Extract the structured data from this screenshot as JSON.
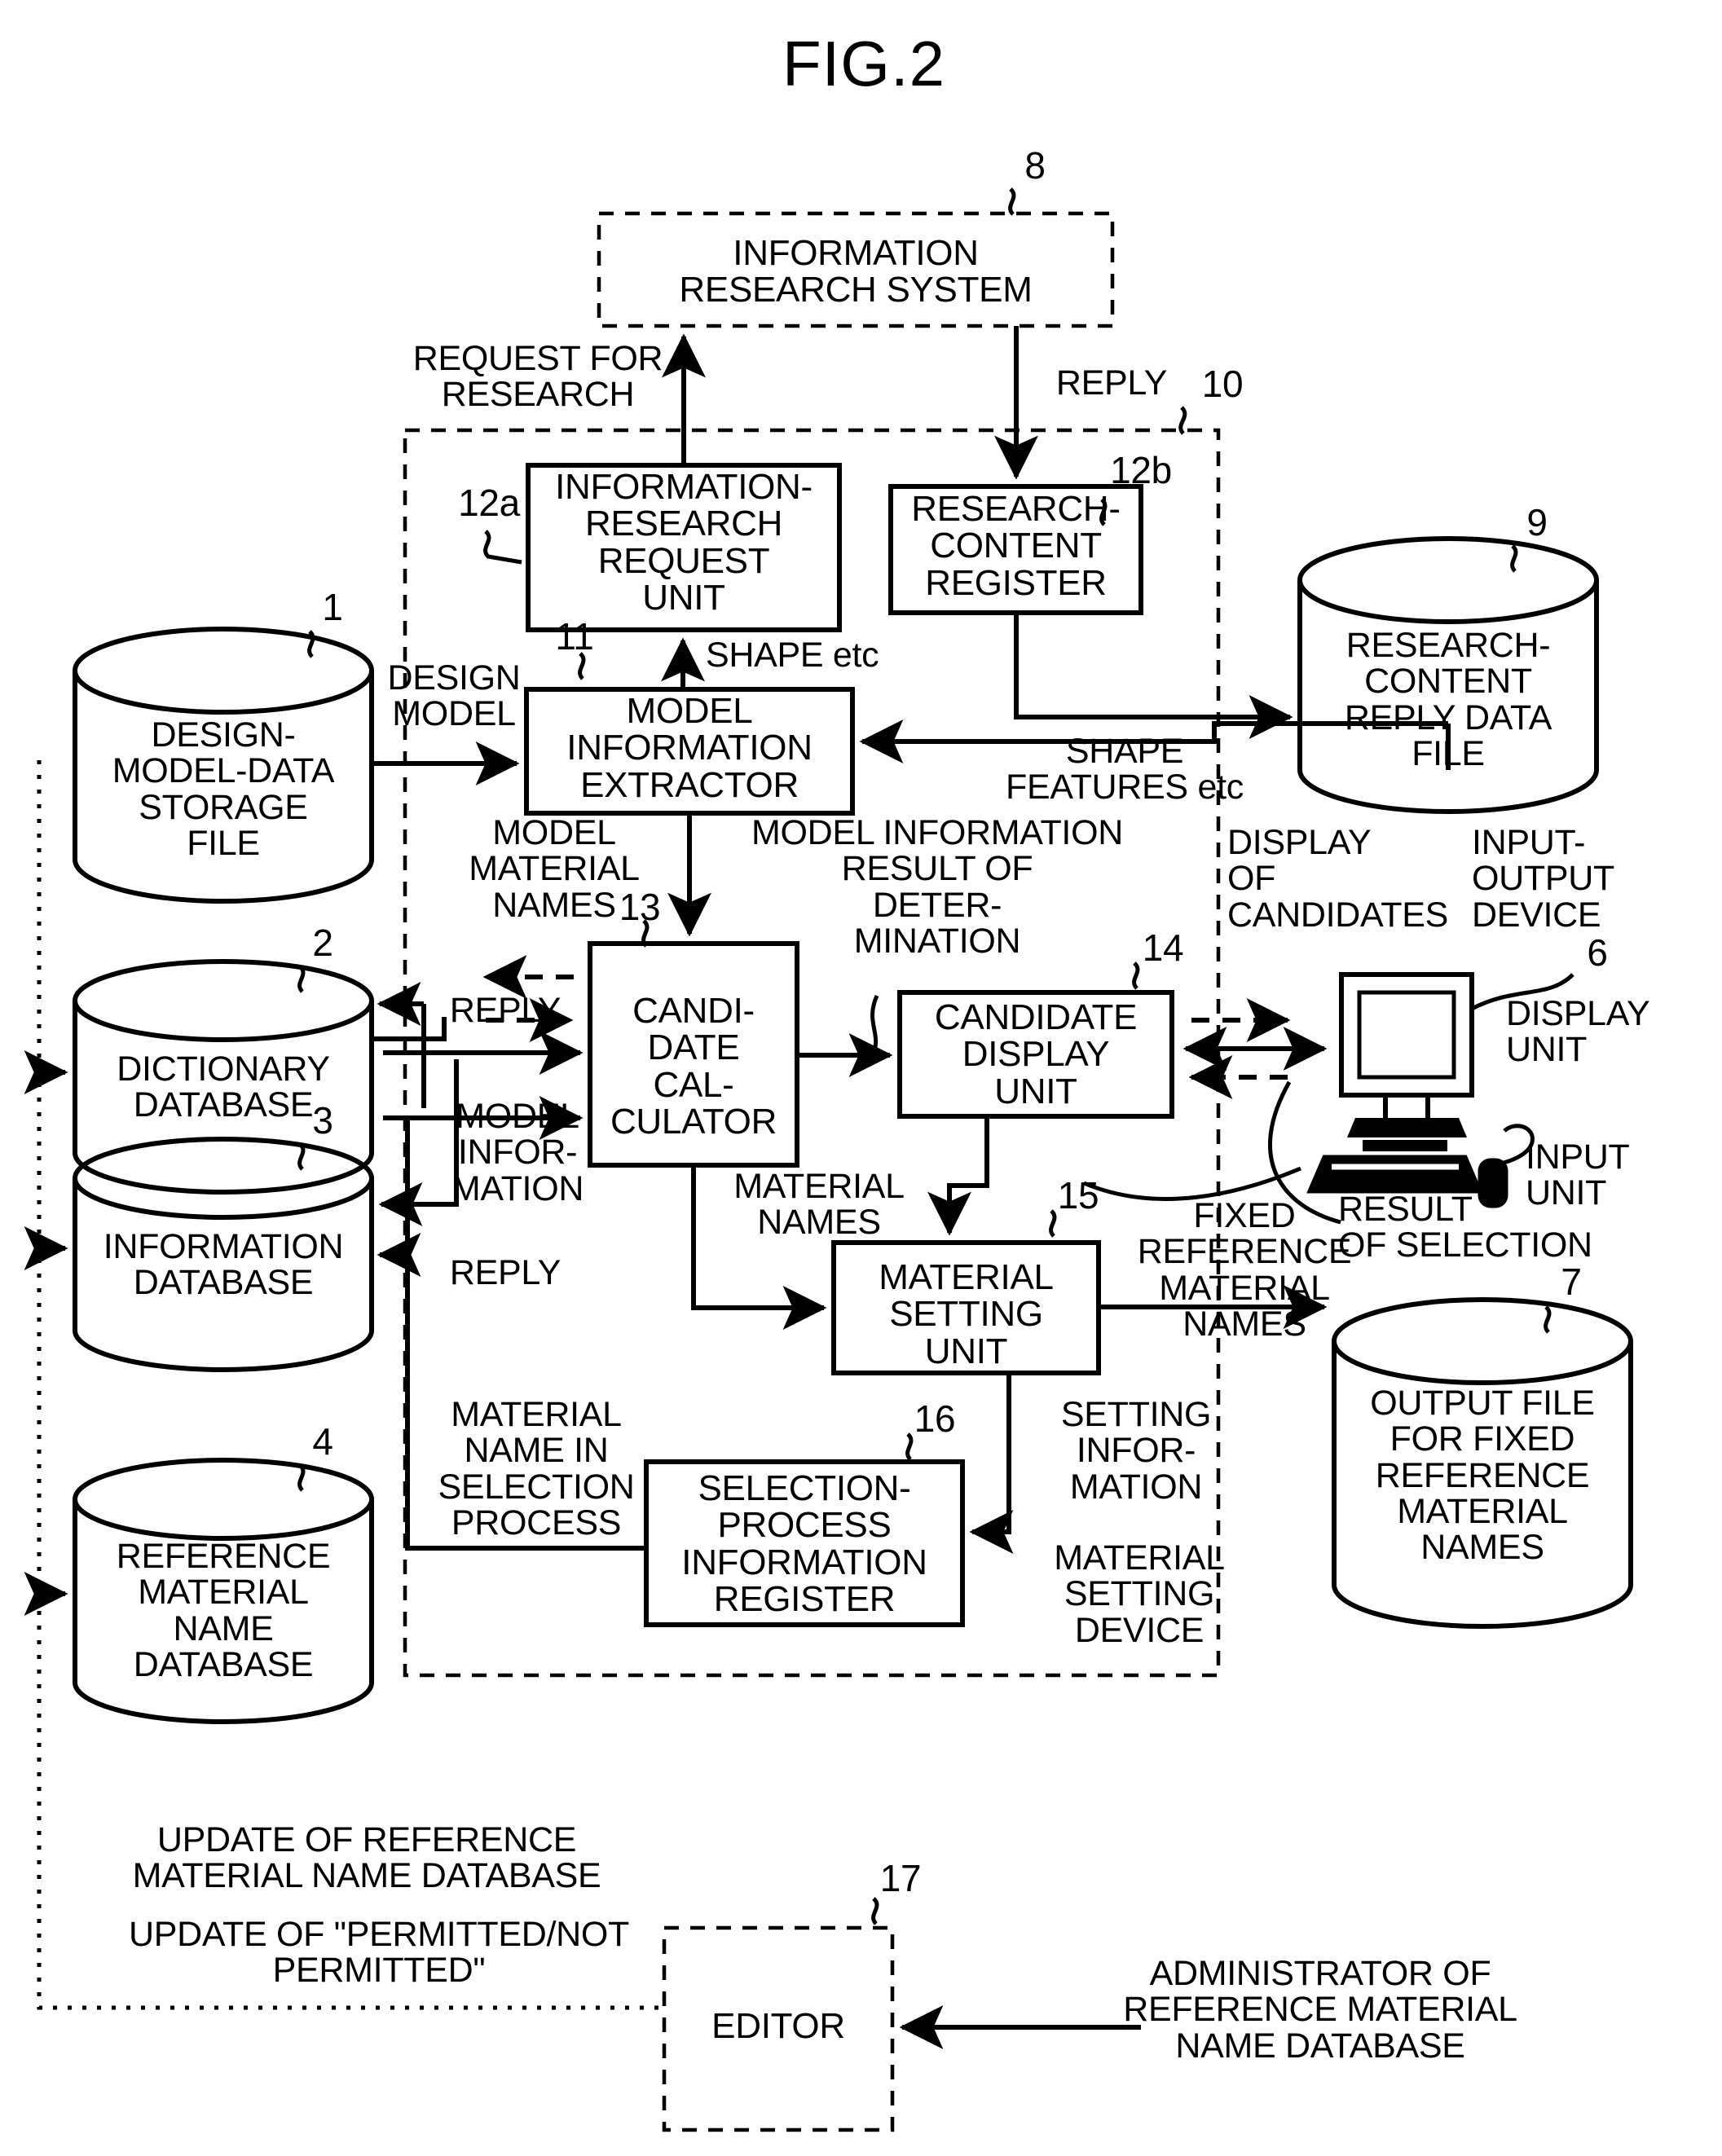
{
  "figure": {
    "title": "FIG.2"
  },
  "boxes": {
    "information_research_system": {
      "label": "INFORMATION\nRESEARCH SYSTEM",
      "ref": "8"
    },
    "information_research_request_unit": {
      "label": "INFORMATION-\nRESEARCH\nREQUEST\nUNIT",
      "ref": "12a"
    },
    "research_content_register": {
      "label": "RESEARCH-\nCONTENT\nREGISTER",
      "ref": "12b"
    },
    "model_information_extractor": {
      "label": "MODEL\nINFORMATION\nEXTRACTOR",
      "ref": "11"
    },
    "candidate_calculator": {
      "label": "CANDI-\nDATE\nCAL-\nCULATOR",
      "ref": "13"
    },
    "candidate_display_unit": {
      "label": "CANDIDATE\nDISPLAY\nUNIT",
      "ref": "14"
    },
    "material_setting_unit": {
      "label": "MATERIAL\nSETTING\nUNIT",
      "ref": "15"
    },
    "selection_process_information_register": {
      "label": "SELECTION-\nPROCESS\nINFORMATION\nREGISTER",
      "ref": "16"
    },
    "editor": {
      "label": "EDITOR",
      "ref": "17"
    },
    "system_boundary": {
      "ref": "10"
    }
  },
  "cylinders": {
    "design_model_data_storage_file": {
      "label": "DESIGN-\nMODEL-DATA\nSTORAGE\nFILE",
      "ref": "1"
    },
    "dictionary_database": {
      "label": "DICTIONARY\nDATABASE",
      "ref": "2"
    },
    "information_database": {
      "label": "INFORMATION\nDATABASE",
      "ref": "3"
    },
    "reference_material_name_database": {
      "label": "REFERENCE\nMATERIAL\nNAME\nDATABASE",
      "ref": "4"
    },
    "research_content_reply_data_file": {
      "label": "RESEARCH-\nCONTENT\nREPLY DATA\nFILE",
      "ref": "9"
    },
    "output_file_fixed_reference_material_names": {
      "label": "OUTPUT FILE\nFOR FIXED\nREFERENCE\nMATERIAL\nNAMES",
      "ref": "7"
    }
  },
  "device": {
    "input_output_device_label": "INPUT-\nOUTPUT\nDEVICE",
    "input_output_device_ref": "6",
    "display_unit_label": "DISPLAY\nUNIT",
    "input_unit_label": "INPUT\nUNIT"
  },
  "flow_labels": {
    "request_for_research": "REQUEST FOR\nRESEARCH",
    "reply_top": "REPLY",
    "design_model": "DESIGN\nMODEL",
    "shape_etc": "SHAPE etc",
    "shape_features_etc": "SHAPE\nFEATURES etc",
    "model_material_names": "MODEL\nMATERIAL\nNAMES",
    "reply_1": "REPLY",
    "model_information_left": "MODEL\nINFOR-\nMATION",
    "reply_2": "REPLY",
    "model_information_result": "MODEL INFORMATION\nRESULT OF\nDETER-\nMINATION",
    "display_of_candidates": "DISPLAY\nOF\nCANDIDATES",
    "material_names": "MATERIAL\nNAMES",
    "result_of_selection": "RESULT\nOF SELECTION",
    "fixed_reference_material_names": "FIXED\nREFERENCE\nMATERIAL\nNAMES",
    "setting_information": "SETTING\nINFOR-\nMATION",
    "material_setting_device": "MATERIAL\nSETTING\nDEVICE",
    "material_name_in_selection_process": "MATERIAL\nNAME IN\nSELECTION\nPROCESS",
    "update_of_reference_material_name_database": "UPDATE OF REFERENCE\nMATERIAL NAME DATABASE",
    "update_of_permitted_not_permitted": "UPDATE OF \"PERMITTED/NOT\nPERMITTED\"",
    "administrator_of_reference_material_name_database": "ADMINISTRATOR OF\nREFERENCE MATERIAL\nNAME DATABASE"
  },
  "colors": {
    "ink": "#000000",
    "paper": "#ffffff"
  }
}
